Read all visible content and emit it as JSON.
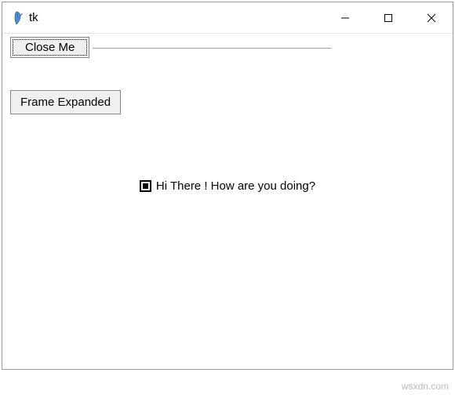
{
  "titlebar": {
    "title": "tk"
  },
  "buttons": {
    "close": "Close Me",
    "expand": "Frame Expanded"
  },
  "checkbox": {
    "label": "Hi There ! How are you doing?"
  },
  "watermark": "wsxdn.com"
}
